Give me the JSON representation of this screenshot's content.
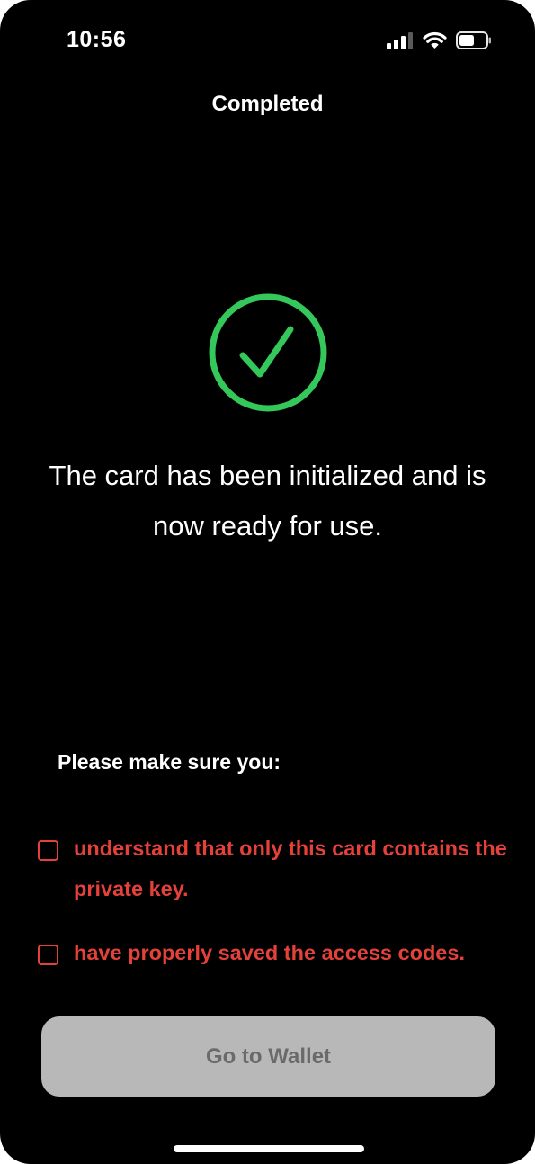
{
  "status_bar": {
    "time": "10:56",
    "icons": [
      "cellular-signal-icon",
      "wifi-icon",
      "battery-icon"
    ]
  },
  "nav": {
    "title": "Completed"
  },
  "success": {
    "icon": "checkmark-circle-icon",
    "accent_color": "#34c759",
    "message": "The card has been initialized and is now ready for use."
  },
  "confirmations": {
    "heading": "Please make sure you:",
    "warning_color": "#e5413b",
    "items": [
      {
        "label": "understand that only this card contains the private key.",
        "checked": false
      },
      {
        "label": "have properly saved the access codes.",
        "checked": false
      }
    ]
  },
  "actions": {
    "primary_label": "Go to Wallet",
    "primary_enabled": false
  }
}
